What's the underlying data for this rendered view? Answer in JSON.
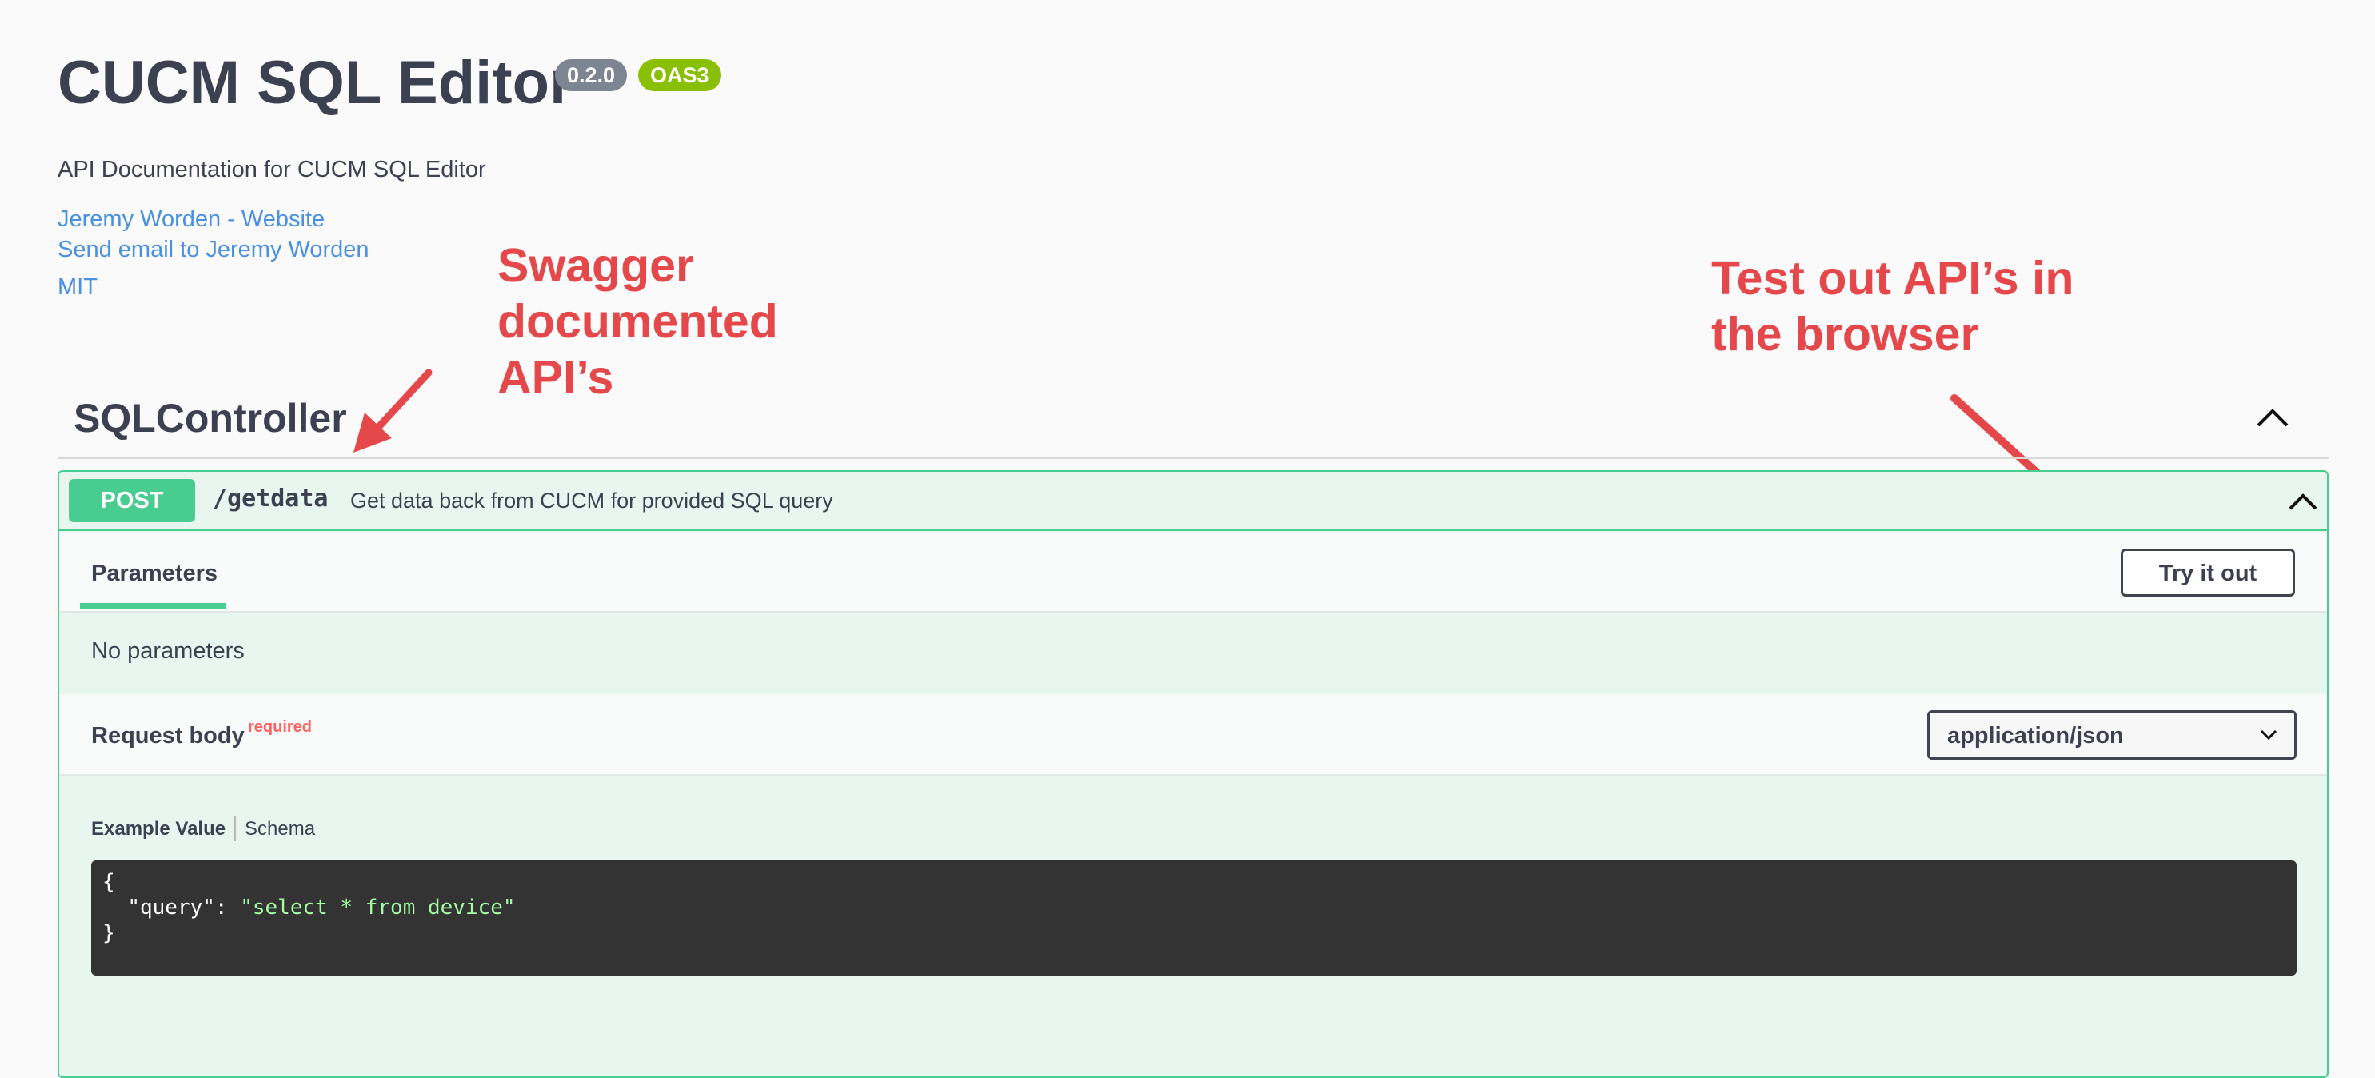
{
  "info": {
    "title": "CUCM SQL Editor",
    "version": "0.2.0",
    "oas": "OAS3",
    "description": "API Documentation for CUCM SQL Editor",
    "links": {
      "website": "Jeremy Worden - Website",
      "email": "Send email to Jeremy Worden",
      "license": "MIT"
    }
  },
  "annotations": {
    "left": [
      "Swagger",
      "documented",
      "API’s"
    ],
    "right": [
      "Test out API’s in",
      "the browser"
    ]
  },
  "section": {
    "title": "SQLController"
  },
  "operation": {
    "method": "POST",
    "path": "/getdata",
    "summary": "Get data back from CUCM for provided SQL query",
    "tab": "Parameters",
    "try_label": "Try it out",
    "no_params": "No parameters",
    "request_body_label": "Request body",
    "required_label": "required",
    "content_type": "application/json",
    "example_tab": "Example Value",
    "schema_tab": "Schema",
    "code": {
      "open": "{",
      "key": "\"query\"",
      "colon": ": ",
      "value": "\"select * from device\"",
      "close": "}"
    }
  },
  "colors": {
    "post": "#49cc90",
    "annotation": "#e5484a",
    "link": "#4990e2",
    "code_bg": "#333333",
    "code_string": "#a2fca2"
  }
}
